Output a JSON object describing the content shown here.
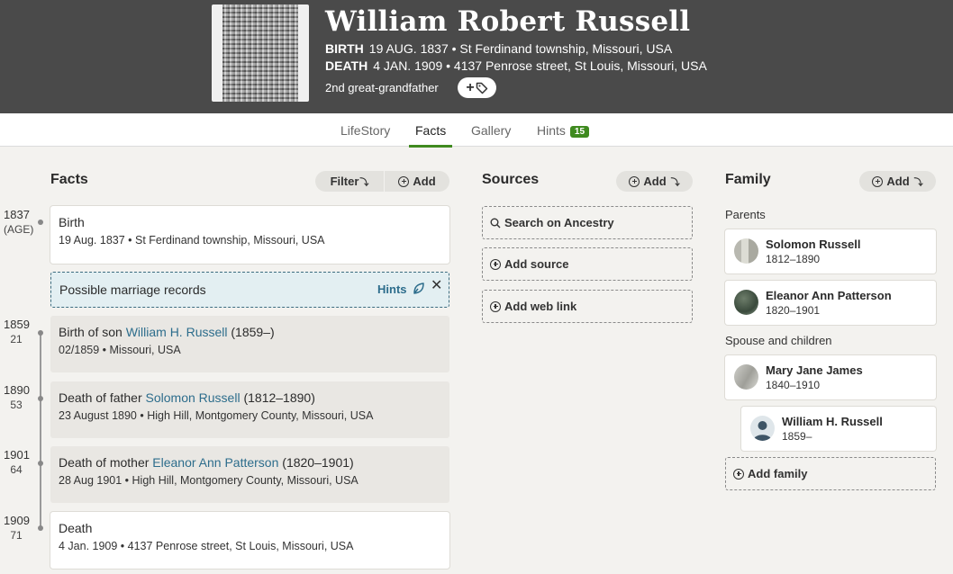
{
  "person": {
    "name": "William Robert Russell",
    "birth_label": "BIRTH",
    "birth_value": "19 AUG. 1837 • St Ferdinand township, Missouri, USA",
    "death_label": "DEATH",
    "death_value": "4 JAN. 1909 • 4137 Penrose street, St Louis, Missouri, USA",
    "relationship": "2nd great-grandfather"
  },
  "tabs": [
    {
      "label": "LifeStory"
    },
    {
      "label": "Facts",
      "active": true
    },
    {
      "label": "Gallery"
    },
    {
      "label": "Hints",
      "badge": "15"
    }
  ],
  "facts_section": {
    "title": "Facts",
    "filter_label": "Filter",
    "add_label": "Add"
  },
  "timeline": [
    {
      "year": "1837",
      "age": "(AGE)"
    },
    {
      "year": "1859",
      "age": "21"
    },
    {
      "year": "1890",
      "age": "53"
    },
    {
      "year": "1901",
      "age": "64"
    },
    {
      "year": "1909",
      "age": "71"
    }
  ],
  "facts": [
    {
      "title": "Birth",
      "detail": "19 Aug. 1837 • St Ferdinand township, Missouri, USA"
    },
    {
      "prefix": "Birth of son ",
      "link": "William H. Russell",
      "suffix": " (1859–)",
      "detail": "02/1859 • Missouri, USA"
    },
    {
      "prefix": "Death of father ",
      "link": "Solomon Russell",
      "suffix": " (1812–1890)",
      "detail": "23 August 1890 • High Hill, Montgomery County, Missouri, USA"
    },
    {
      "prefix": "Death of mother ",
      "link": "Eleanor Ann Patterson",
      "suffix": " (1820–1901)",
      "detail": "28 Aug 1901 • High Hill, Montgomery County, Missouri, USA"
    },
    {
      "title": "Death",
      "detail": "4 Jan. 1909 • 4137 Penrose street, St Louis, Missouri, USA"
    }
  ],
  "hint_card": {
    "text": "Possible marriage records",
    "hints_label": "Hints"
  },
  "sources_section": {
    "title": "Sources",
    "add_label": "Add",
    "search_label": "Search on Ancestry",
    "add_source_label": "Add source",
    "add_web_link_label": "Add web link"
  },
  "family_section": {
    "title": "Family",
    "add_label": "Add",
    "parents_label": "Parents",
    "spouse_label": "Spouse and children",
    "add_family_label": "Add family",
    "parents": [
      {
        "name": "Solomon Russell",
        "dates": "1812–1890"
      },
      {
        "name": "Eleanor Ann Patterson",
        "dates": "1820–1901"
      }
    ],
    "spouse": {
      "name": "Mary Jane James",
      "dates": "1840–1910"
    },
    "children": [
      {
        "name": "William H. Russell",
        "dates": "1859–"
      }
    ]
  },
  "colors": {
    "header_bg": "#4a4a4a",
    "accent_green": "#3f8a1f",
    "link_blue": "#2d6d8c",
    "hint_bg": "#e3eff2"
  }
}
